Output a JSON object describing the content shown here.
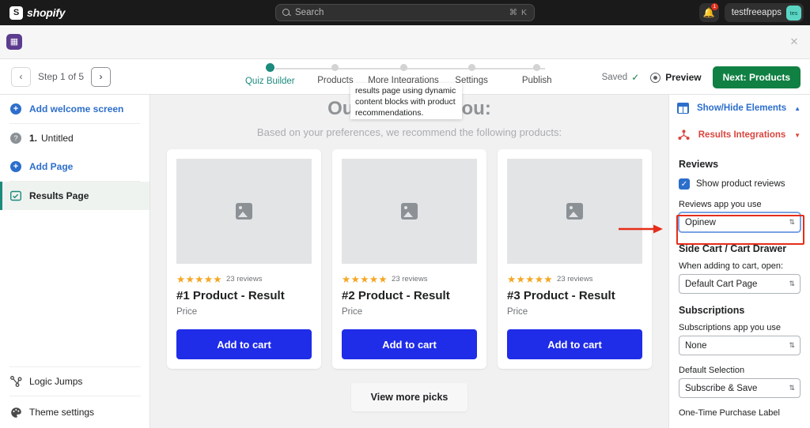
{
  "topbar": {
    "brand": "shopify",
    "brand_mark": "S",
    "search": {
      "placeholder": "Search",
      "shortcut": "⌘ K",
      "icon": "search-icon"
    },
    "notifications": {
      "icon": "bell-icon",
      "badge": "1"
    },
    "user": {
      "name": "testfreeapps",
      "avatar_initials": "tes"
    }
  },
  "subheader": {
    "app_icon": "app-icon",
    "app_glyph": "▦",
    "close_label": "✕"
  },
  "toolbar": {
    "prev_label": "‹",
    "next_label": "›",
    "step_label": "Step 1 of 5",
    "saved_label": "Saved",
    "saved_check": "✓",
    "preview_label": "Preview",
    "next_button_label": "Next: Products",
    "accent_green": "#108043",
    "accent_teal": "#1c8a7d"
  },
  "stepper": {
    "steps": [
      {
        "name": "Quiz Builder",
        "active": true
      },
      {
        "name": "Products",
        "active": false
      },
      {
        "name": "More Integrations",
        "active": false
      },
      {
        "name": "Settings",
        "active": false
      },
      {
        "name": "Publish",
        "active": false
      }
    ]
  },
  "sidebar": {
    "items": [
      {
        "label": "Add welcome screen",
        "icon": "plus-circle-icon",
        "kind": "link"
      },
      {
        "label": "Untitled",
        "number": "1.",
        "icon": "question-circle-icon",
        "kind": "page"
      },
      {
        "label": "Add Page",
        "icon": "plus-circle-icon",
        "kind": "link"
      },
      {
        "label": "Results Page",
        "icon": "results-page-icon",
        "kind": "selected"
      }
    ],
    "bottom_items": [
      {
        "label": "Logic Jumps",
        "icon": "logic-jumps-icon"
      },
      {
        "label": "Theme settings",
        "icon": "palette-icon"
      }
    ]
  },
  "tooltip": {
    "text": "results page using dynamic content blocks with product recommendations."
  },
  "canvas": {
    "title": "Our picks for you:",
    "subtitle": "Based on your preferences, we recommend the following products:",
    "view_more_label": "View more picks",
    "cards": [
      {
        "stars": "★★★★★",
        "reviews": "23 reviews",
        "title": "#1 Product - Result",
        "price": "Price",
        "cta": "Add to cart",
        "image_icon": "image-placeholder-icon"
      },
      {
        "stars": "★★★★★",
        "reviews": "23 reviews",
        "title": "#2 Product - Result",
        "price": "Price",
        "cta": "Add to cart",
        "image_icon": "image-placeholder-icon"
      },
      {
        "stars": "★★★★★",
        "reviews": "23 reviews",
        "title": "#3 Product - Result",
        "price": "Price",
        "cta": "Add to cart",
        "image_icon": "image-placeholder-icon"
      }
    ],
    "cta_color": "#1f2ce8"
  },
  "right_panel": {
    "accordions": [
      {
        "label": "Show/Hide Elements",
        "caret": "▲",
        "color": "#2c6ecb",
        "icon": "layout-icon"
      },
      {
        "label": "Results Integrations",
        "caret": "▼",
        "color": "#d9453d",
        "icon": "integrations-icon"
      }
    ],
    "sections": {
      "reviews": {
        "heading": "Reviews",
        "checkbox_label": "Show product reviews",
        "checkbox_checked": "✓",
        "field_label": "Reviews app you use",
        "field_value": "Opinew",
        "highlight_color": "#e52d1b"
      },
      "side_cart": {
        "heading": "Side Cart / Cart Drawer",
        "field_label": "When adding to cart, open:",
        "field_value": "Default Cart Page"
      },
      "subscriptions": {
        "heading": "Subscriptions",
        "app_label": "Subscriptions app you use",
        "app_value": "None",
        "default_label": "Default Selection",
        "default_value": "Subscribe & Save",
        "next_label_partial": "One-Time Purchase Label"
      }
    },
    "stepper_glyph": "⇅"
  }
}
